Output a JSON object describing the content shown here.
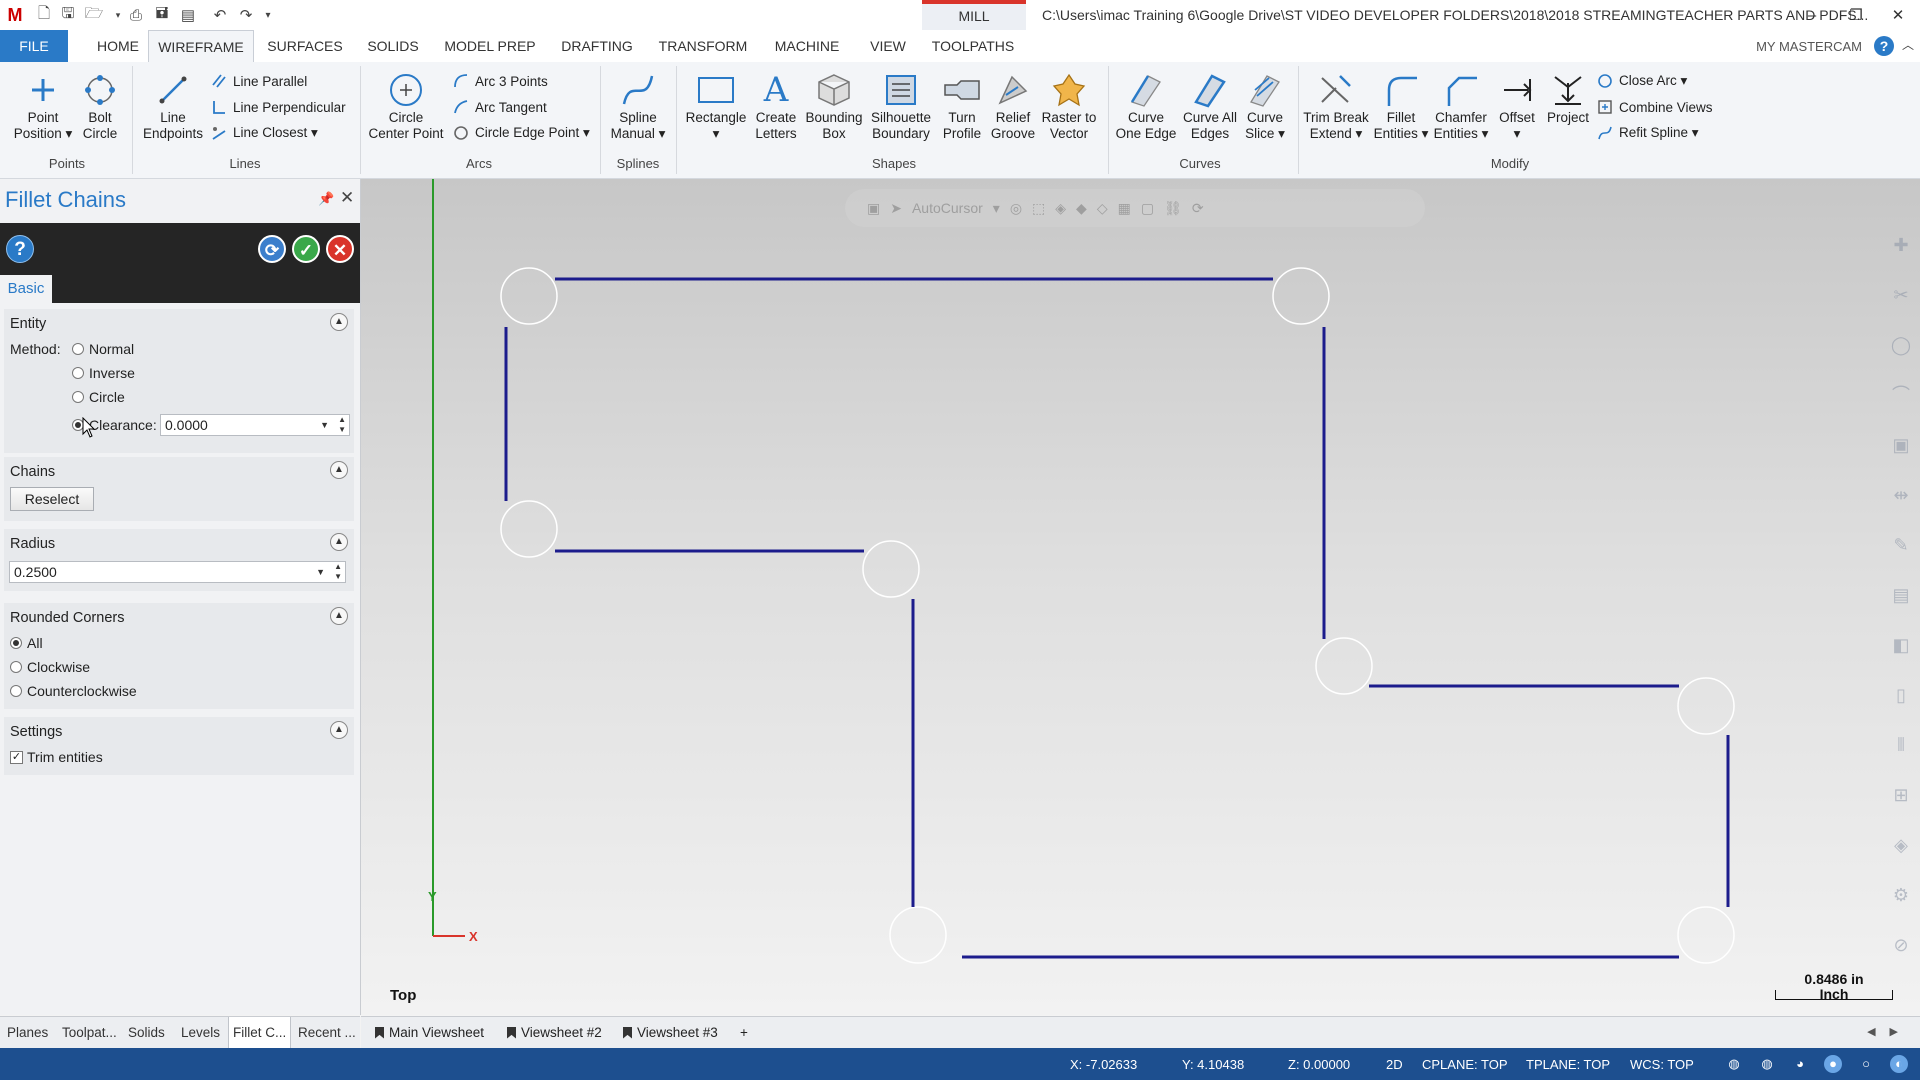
{
  "window": {
    "mode_tab": "MILL",
    "title": "C:\\Users\\imac Training 6\\Google Drive\\ST VIDEO DEVELOPER FOLDERS\\2018\\2018 STREAMINGTEACHER PARTS AND PDFS..."
  },
  "tabs": [
    "FILE",
    "HOME",
    "WIREFRAME",
    "SURFACES",
    "SOLIDS",
    "MODEL PREP",
    "DRAFTING",
    "TRANSFORM",
    "MACHINE",
    "VIEW",
    "TOOLPATHS"
  ],
  "active_tab": "WIREFRAME",
  "my_mastercam": "MY MASTERCAM",
  "ribbon": {
    "groups": {
      "points": "Points",
      "lines": "Lines",
      "arcs": "Arcs",
      "splines": "Splines",
      "shapes": "Shapes",
      "curves": "Curves",
      "modify": "Modify"
    },
    "buttons": {
      "point_position": "Point\nPosition ▾",
      "bolt_circle": "Bolt\nCircle",
      "line_endpoints": "Line\nEndpoints",
      "line_parallel": "Line Parallel",
      "line_perpendicular": "Line Perpendicular",
      "line_closest": "Line Closest ▾",
      "circle_center_point": "Circle\nCenter Point",
      "arc_3_points": "Arc 3 Points",
      "arc_tangent": "Arc Tangent",
      "circle_edge_point": "Circle Edge Point ▾",
      "spline_manual": "Spline\nManual ▾",
      "rectangle": "Rectangle\n▾",
      "create_letters": "Create\nLetters",
      "bounding_box": "Bounding\nBox",
      "silhouette_boundary": "Silhouette\nBoundary",
      "turn_profile": "Turn\nProfile",
      "relief_groove": "Relief\nGroove",
      "raster_to_vector": "Raster to\nVector",
      "curve_one_edge": "Curve\nOne Edge",
      "curve_all_edges": "Curve All\nEdges",
      "curve_slice": "Curve\nSlice ▾",
      "trim_break_extend": "Trim Break\nExtend ▾",
      "fillet_entities": "Fillet\nEntities ▾",
      "chamfer_entities": "Chamfer\nEntities ▾",
      "offset": "Offset\n▾",
      "project": "Project",
      "close_arc": "Close Arc ▾",
      "combine_views": "Combine Views",
      "refit_spline": "Refit Spline ▾"
    }
  },
  "panel": {
    "title": "Fillet Chains",
    "tab": "Basic",
    "entity": {
      "title": "Entity",
      "method_label": "Method:",
      "options": [
        "Normal",
        "Inverse",
        "Circle",
        "Clearance:"
      ],
      "selected": "Clearance:",
      "clearance_value": "0.0000"
    },
    "chains": {
      "title": "Chains",
      "reselect": "Reselect"
    },
    "radius": {
      "title": "Radius",
      "value": "0.2500"
    },
    "rounded_corners": {
      "title": "Rounded Corners",
      "options": [
        "All",
        "Clockwise",
        "Counterclockwise"
      ],
      "selected": "All"
    },
    "settings": {
      "title": "Settings",
      "trim_entities": "Trim entities",
      "trim_checked": true
    }
  },
  "panel_tabs": [
    "Planes",
    "Toolpat...",
    "Solids",
    "Levels",
    "Fillet C...",
    "Recent ..."
  ],
  "active_panel_tab": "Fillet C...",
  "viewport": {
    "view_name": "Top",
    "axis_x": "X",
    "axis_y": "Y",
    "scale_value": "0.8486 in",
    "scale_unit": "Inch",
    "toolbar_hint": "AutoCursor"
  },
  "viewsheets": [
    "Main Viewsheet",
    "Viewsheet #2",
    "Viewsheet #3"
  ],
  "viewsheet_add": "+",
  "status": {
    "x": "X:  -7.02633",
    "y": "Y:  4.10438",
    "z": "Z:  0.00000",
    "mode": "2D",
    "cplane": "CPLANE: TOP",
    "tplane": "TPLANE: TOP",
    "wcs": "WCS: TOP"
  },
  "colors": {
    "accent": "#2a7ac7",
    "geometry": "#1c1c8c",
    "status_bar": "#1d4f8f",
    "mill_tab": "#d9342b"
  }
}
